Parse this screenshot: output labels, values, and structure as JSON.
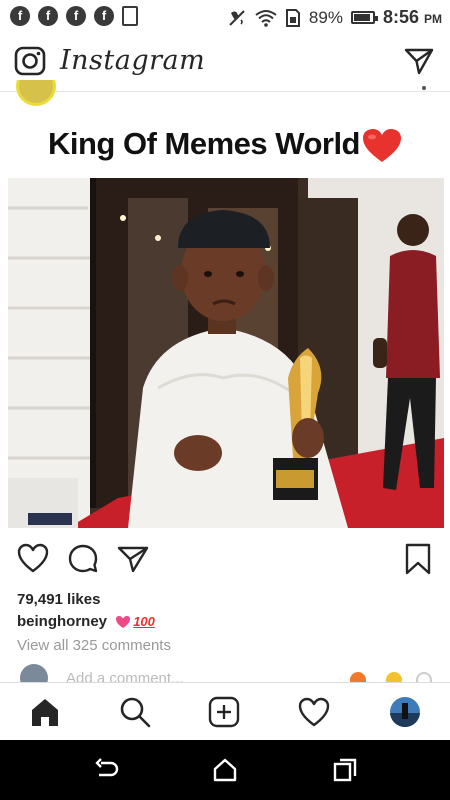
{
  "status_bar": {
    "battery_percent": "89%",
    "time": "8:56",
    "ampm": "PM",
    "left_icons": [
      "facebook-icon",
      "facebook-icon",
      "facebook-icon",
      "facebook-icon",
      "tablet-icon"
    ],
    "right_icons": [
      "mute-vibrate-icon",
      "wifi-icon",
      "sim-icon",
      "battery-icon"
    ]
  },
  "header": {
    "brand": "Instagram",
    "left_icon": "camera-icon",
    "right_icon": "direct-send-icon"
  },
  "post": {
    "image_caption_text": "King Of Memes World",
    "caption_emoji": "red-heart",
    "likes": "79,491 likes",
    "comment_user": "beinghorney",
    "comment_emojis": [
      "pink-heart",
      "hundred-points"
    ],
    "comment_hundred": "100",
    "view_comments": "View all 325 comments",
    "add_comment_placeholder": "Add a comment..."
  },
  "tabs": [
    "home-icon",
    "search-icon",
    "new-post-icon",
    "activity-heart-icon",
    "profile-avatar"
  ],
  "system_nav": [
    "back-icon",
    "home-icon",
    "recents-icon"
  ],
  "colors": {
    "heart_red": "#e8322e",
    "text": "#262626",
    "muted": "#999999",
    "divider": "#dbdbdb"
  }
}
